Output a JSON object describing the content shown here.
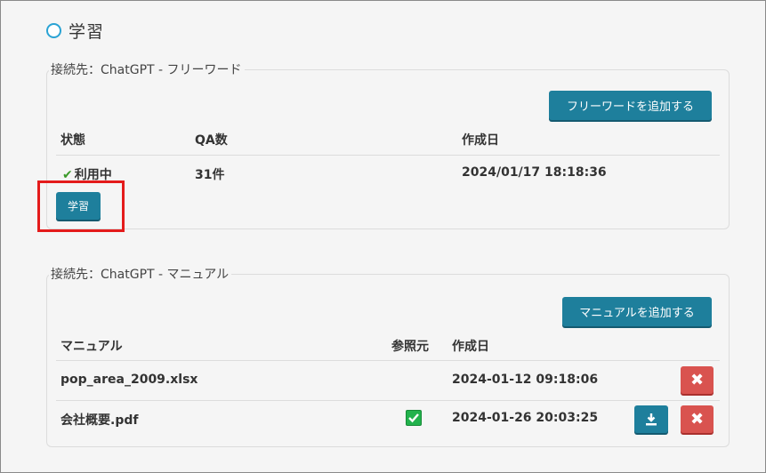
{
  "section": {
    "title": "学習",
    "icon": "circle-icon"
  },
  "freeword_panel": {
    "legend": "接続先：ChatGPT - フリーワード",
    "add_button": "フリーワードを追加する",
    "columns": [
      "状態",
      "QA数",
      "作成日"
    ],
    "row": {
      "status": "利用中",
      "qa_count": "31件",
      "created": "2024/01/17 18:18:36"
    },
    "learn_button": "学習"
  },
  "manual_panel": {
    "legend": "接続先：ChatGPT - マニュアル",
    "add_button": "マニュアルを追加する",
    "columns": [
      "マニュアル",
      "参照元",
      "作成日"
    ],
    "rows": [
      {
        "name": "pop_area_2009.xlsx",
        "reference": "",
        "created": "2024-01-12 09:18:06"
      },
      {
        "name": "会社概要.pdf",
        "reference": "checked",
        "created": "2024-01-26 20:03:25"
      }
    ]
  },
  "colors": {
    "primary": "#1e7f9c",
    "danger": "#d9534f",
    "highlight": "#e41b1b",
    "success": "#22b24c"
  }
}
